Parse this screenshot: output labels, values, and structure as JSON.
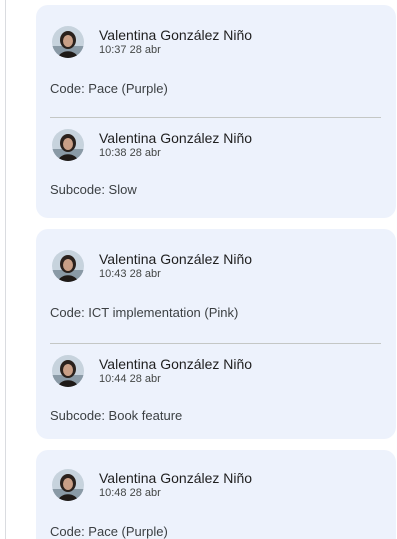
{
  "threads": [
    {
      "comments": [
        {
          "author": "Valentina González Niño",
          "time": "10:37 28 abr",
          "text": "Code: Pace (Purple)"
        },
        {
          "author": "Valentina González Niño",
          "time": "10:38 28 abr",
          "text": "Subcode: Slow"
        }
      ]
    },
    {
      "comments": [
        {
          "author": "Valentina González Niño",
          "time": "10:43 28 abr",
          "text": "Code: ICT implementation (Pink)"
        },
        {
          "author": "Valentina González Niño",
          "time": "10:44 28 abr",
          "text": "Subcode: Book feature"
        }
      ]
    },
    {
      "comments": [
        {
          "author": "Valentina González Niño",
          "time": "10:48 28 abr",
          "text": "Code: Pace (Purple)"
        }
      ]
    }
  ],
  "colors": {
    "thread_bg": "#edf2fc",
    "author": "#1f1f1f",
    "time": "#444746",
    "text": "#3c4043"
  }
}
